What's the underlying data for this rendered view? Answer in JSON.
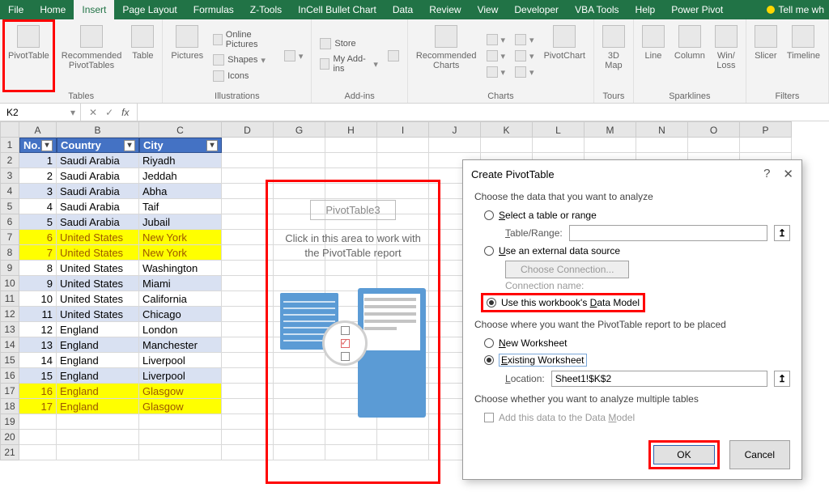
{
  "tabs": [
    "File",
    "Home",
    "Insert",
    "Page Layout",
    "Formulas",
    "Z-Tools",
    "InCell Bullet Chart",
    "Data",
    "Review",
    "View",
    "Developer",
    "VBA Tools",
    "Help",
    "Power Pivot"
  ],
  "active_tab": "Insert",
  "tellme": "Tell me wh",
  "ribbon": {
    "tables": {
      "pivot": "PivotTable",
      "rec": "Recommended\nPivotTables",
      "table": "Table",
      "label": "Tables"
    },
    "illus": {
      "pic": "Pictures",
      "online": "Online Pictures",
      "shapes": "Shapes",
      "icons": "Icons",
      "label": "Illustrations"
    },
    "addins": {
      "store": "Store",
      "my": "My Add-ins",
      "label": "Add-ins"
    },
    "charts": {
      "rec": "Recommended\nCharts",
      "pc": "PivotChart",
      "label": "Charts"
    },
    "tours": {
      "map": "3D\nMap",
      "label": "Tours"
    },
    "spark": {
      "line": "Line",
      "col": "Column",
      "wl": "Win/\nLoss",
      "label": "Sparklines"
    },
    "filters": {
      "slicer": "Slicer",
      "tl": "Timeline",
      "label": "Filters"
    }
  },
  "namebox": "K2",
  "fx_fns": {
    "cancel": "✕",
    "enter": "✓",
    "fx": "fx"
  },
  "columns": [
    "A",
    "B",
    "C",
    "D",
    "G",
    "H",
    "I",
    "J",
    "K",
    "L",
    "M",
    "N",
    "O",
    "P"
  ],
  "headers": {
    "no": "No.",
    "country": "Country",
    "city": "City"
  },
  "rows": [
    {
      "n": 1,
      "co": "Saudi Arabia",
      "ci": "Riyadh",
      "hl": false
    },
    {
      "n": 2,
      "co": "Saudi Arabia",
      "ci": "Jeddah",
      "hl": false
    },
    {
      "n": 3,
      "co": "Saudi Arabia",
      "ci": "Abha",
      "hl": false
    },
    {
      "n": 4,
      "co": "Saudi Arabia",
      "ci": "Taif",
      "hl": false
    },
    {
      "n": 5,
      "co": "Saudi Arabia",
      "ci": "Jubail",
      "hl": false
    },
    {
      "n": 6,
      "co": "United States",
      "ci": "New York",
      "hl": true
    },
    {
      "n": 7,
      "co": "United States",
      "ci": "New York",
      "hl": true
    },
    {
      "n": 8,
      "co": "United States",
      "ci": "Washington",
      "hl": false
    },
    {
      "n": 9,
      "co": "United States",
      "ci": "Miami",
      "hl": false
    },
    {
      "n": 10,
      "co": "United States",
      "ci": "California",
      "hl": false
    },
    {
      "n": 11,
      "co": "United States",
      "ci": "Chicago",
      "hl": false
    },
    {
      "n": 12,
      "co": "England",
      "ci": "London",
      "hl": false
    },
    {
      "n": 13,
      "co": "England",
      "ci": "Manchester",
      "hl": false
    },
    {
      "n": 14,
      "co": "England",
      "ci": "Liverpool",
      "hl": false
    },
    {
      "n": 15,
      "co": "England",
      "ci": "Liverpool",
      "hl": false
    },
    {
      "n": 16,
      "co": "England",
      "ci": "Glasgow",
      "hl": true
    },
    {
      "n": 17,
      "co": "England",
      "ci": "Glasgow",
      "hl": true
    }
  ],
  "placeholder": {
    "name": "PivotTable3",
    "hint": "Click in this area to work with the PivotTable report"
  },
  "dialog": {
    "title": "Create PivotTable",
    "help": "?",
    "close": "✕",
    "s1": "Choose the data that you want to analyze",
    "opt_select": "Select a table or range",
    "tr_label": "Table/Range:",
    "tr_value": "",
    "opt_ext": "Use an external data source",
    "choose_conn": "Choose Connection...",
    "conn_label": "Connection name:",
    "opt_dm": "Use this workbook's Data Model",
    "s2": "Choose where you want the PivotTable report to be placed",
    "opt_new": "New Worksheet",
    "opt_exist": "Existing Worksheet",
    "loc_label": "Location:",
    "loc_value": "Sheet1!$K$2",
    "s3": "Choose whether you want to analyze multiple tables",
    "add_dm": "Add this data to the Data Model",
    "ok": "OK",
    "cancel": "Cancel"
  }
}
